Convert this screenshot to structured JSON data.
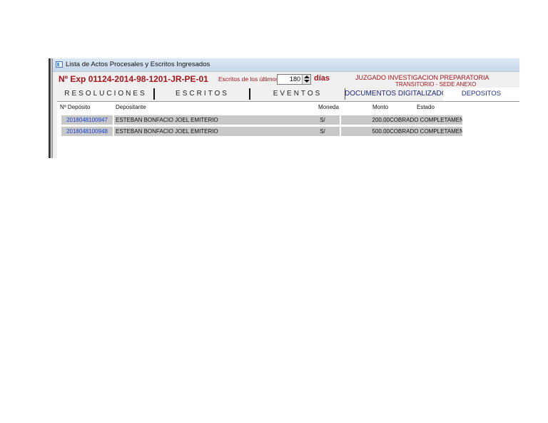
{
  "window": {
    "title": "Lista de Actos Procesales y Escritos Ingresados",
    "icon": "window-icon"
  },
  "header": {
    "exp_number": "Nº Exp 01124-2014-98-1201-JR-PE-01",
    "escritos_label": "Escritos de los últimos",
    "days_value": "180",
    "dias_label": "días",
    "court_line1": "JUZGADO INVESTIGACION PREPARATORIA",
    "court_line2": "TRANSITORIO - SEDE ANEXO"
  },
  "tabs": [
    {
      "label": "RESOLUCIONES"
    },
    {
      "label": "ESCRITOS"
    },
    {
      "label": "EVENTOS"
    },
    {
      "label": "DOCUMENTOS DIGITALIZADOS"
    },
    {
      "label": "DEPOSITOS"
    }
  ],
  "grid": {
    "columns": [
      "Nº Depósito",
      "Depositante",
      "Moneda",
      "Monto",
      "Estado"
    ],
    "rows": [
      {
        "numero": "2018048100947",
        "depositante": "ESTEBAN BONFACIO JOEL EMITERIO",
        "moneda": "S/",
        "monto": "200.00",
        "estado": "COBRADO COMPLETAMENT"
      },
      {
        "numero": "2018048100948",
        "depositante": "ESTEBAN BONFACIO JOEL EMITERIO",
        "moneda": "S/",
        "monto": "500.00",
        "estado": "COBRADO COMPLETAMENT"
      }
    ]
  },
  "colors": {
    "accent_red": "#a8141b",
    "link_blue": "#1c3fd8",
    "tab_blue": "#1c2a80",
    "row_gray": "#c8c8c8"
  }
}
